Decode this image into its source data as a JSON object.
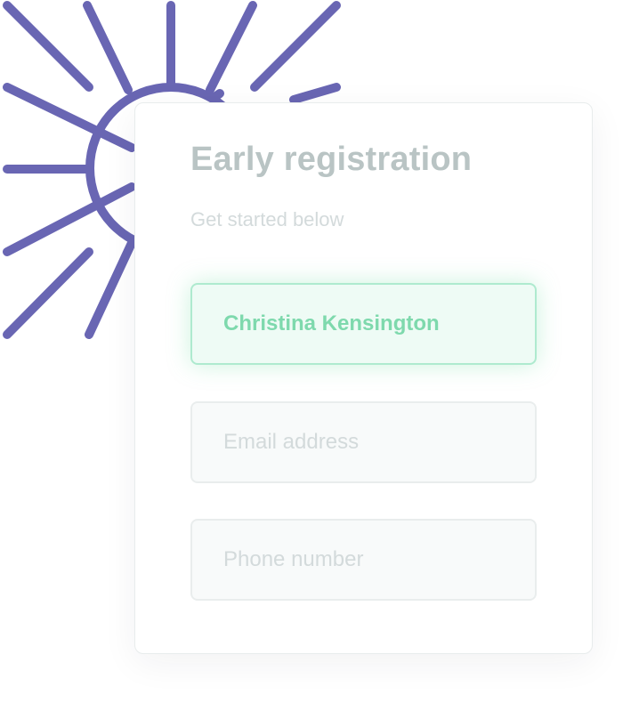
{
  "decoration": {
    "icon": "sun-icon",
    "color": "#6966b3"
  },
  "form": {
    "title": "Early registration",
    "subtitle": "Get started below",
    "fields": {
      "name": {
        "value": "Christina Kensington",
        "state": "focused",
        "accent_color": "#7ed9ad"
      },
      "email": {
        "value": "",
        "placeholder": "Email address"
      },
      "phone": {
        "value": "",
        "placeholder": "Phone number"
      }
    }
  }
}
